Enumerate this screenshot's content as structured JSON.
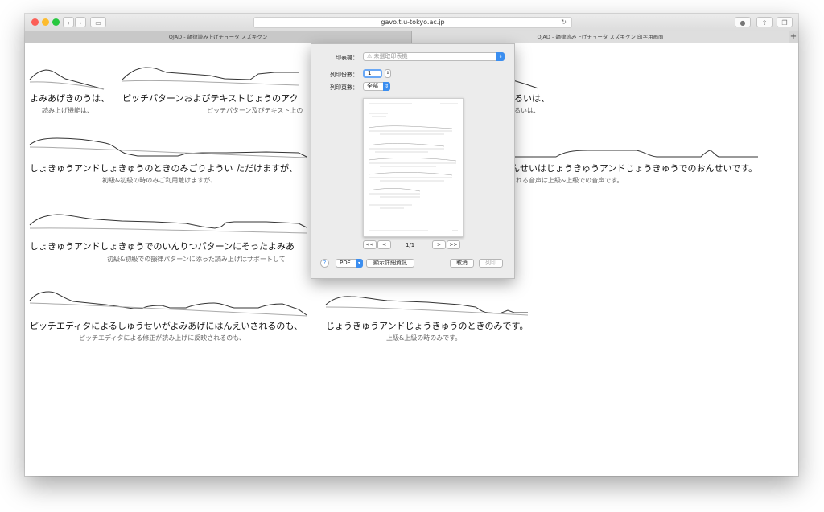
{
  "browser": {
    "url": "gavo.t.u-tokyo.ac.jp",
    "tabs": [
      {
        "label": "OJAD - 韻律読み上げチュータ スズキクン"
      },
      {
        "label": "OJAD - 韻律読み上げチュータ スズキクン 印字用画面"
      }
    ],
    "new_tab_symbol": "+"
  },
  "sentences": [
    {
      "reading": "よみあげきのうは、",
      "gloss": "読み上げ機能は、"
    },
    {
      "reading": "ピッチパターンおよびテキストじょうのアク",
      "gloss": "ピッチパターン及びテキスト上の"
    },
    {
      "reading": "るいは、",
      "gloss": "るいは、"
    },
    {
      "reading": "しょきゅうアンドしょきゅうのときのみごりようい ただけますが、",
      "gloss": "初級&初級の時のみご利用戴けますが、"
    },
    {
      "reading": "んせいはじょうきゅうアンドじょうきゅうでのおんせいです。",
      "gloss": "れる音声は上級&上級での音声です。"
    },
    {
      "reading": "しょきゅうアンドしょきゅうでのいんりつパターンにそったよみあ",
      "gloss": "初級&初級での韻律パターンに添った読み上げはサポートして"
    },
    {
      "reading": "ピッチエディタによるしゅうせいがよみあげにはんえいされるのも、",
      "gloss": "ピッチエディタによる修正が読み上げに反映されるのも、"
    },
    {
      "reading": "じょうきゅうアンドじょうきゅうのときのみです。",
      "gloss": "上級&上級の時のみです。"
    }
  ],
  "print_dialog": {
    "printer_label": "印表機：",
    "printer_value": "未選取印表機",
    "copies_label": "列印份數：",
    "copies_value": "1",
    "pages_label": "列印頁數：",
    "pages_value": "全部",
    "page_indicator": "1/1",
    "pdf_label": "PDF",
    "help_label": "?",
    "details_label": "顯示詳細資訊",
    "cancel_label": "取消",
    "print_label": "列印",
    "nav_first": "<<",
    "nav_prev": "<",
    "nav_next": ">",
    "nav_last": ">>"
  }
}
